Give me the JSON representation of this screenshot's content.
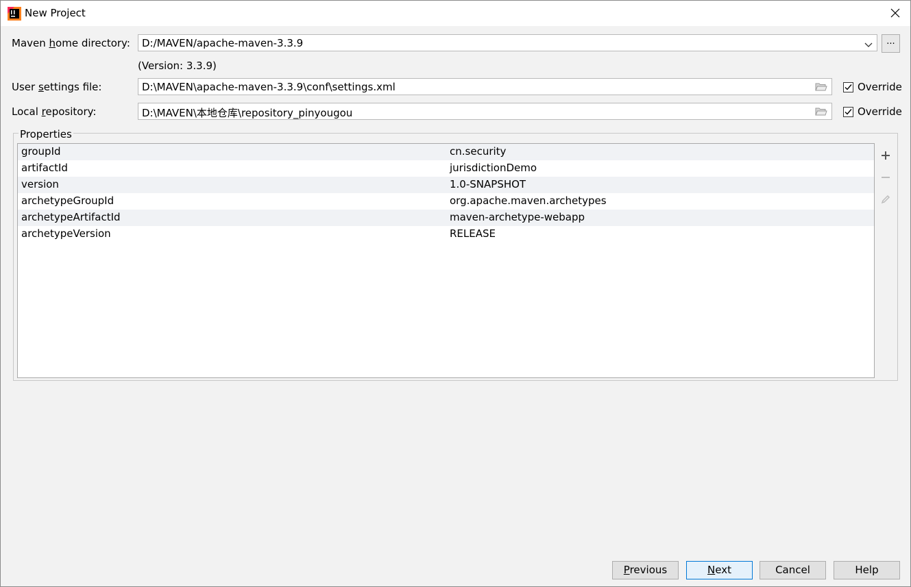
{
  "window": {
    "title": "New Project"
  },
  "maven_home": {
    "label_pre": "Maven ",
    "label_mnemonic": "h",
    "label_post": "ome directory:",
    "value": "D:/MAVEN/apache-maven-3.3.9",
    "browse_label": "...",
    "version_note": "(Version: 3.3.9)"
  },
  "user_settings": {
    "label_pre": "User ",
    "label_mnemonic": "s",
    "label_post": "ettings file:",
    "value": "D:\\MAVEN\\apache-maven-3.3.9\\conf\\settings.xml",
    "override_label": "Override",
    "override_checked": true
  },
  "local_repo": {
    "label_pre": "Local ",
    "label_mnemonic": "r",
    "label_post": "epository:",
    "value": "D:\\MAVEN\\本地仓库\\repository_pinyougou",
    "override_label": "Override",
    "override_checked": true
  },
  "properties": {
    "title": "Properties",
    "rows": [
      {
        "key": "groupId",
        "value": "cn.security"
      },
      {
        "key": "artifactId",
        "value": "jurisdictionDemo"
      },
      {
        "key": "version",
        "value": "1.0-SNAPSHOT"
      },
      {
        "key": "archetypeGroupId",
        "value": "org.apache.maven.archetypes"
      },
      {
        "key": "archetypeArtifactId",
        "value": "maven-archetype-webapp"
      },
      {
        "key": "archetypeVersion",
        "value": "RELEASE"
      }
    ],
    "toolbar": [
      "add-icon",
      "remove-icon",
      "edit-icon"
    ]
  },
  "buttons": {
    "previous": {
      "mnemonic": "P",
      "rest": "revious"
    },
    "next": {
      "mnemonic": "N",
      "rest": "ext"
    },
    "cancel": "Cancel",
    "help": "Help"
  },
  "colors": {
    "dialog_bg": "#f2f2f2",
    "alt_row": "#f0f2f5",
    "primary_border": "#0078d7"
  }
}
